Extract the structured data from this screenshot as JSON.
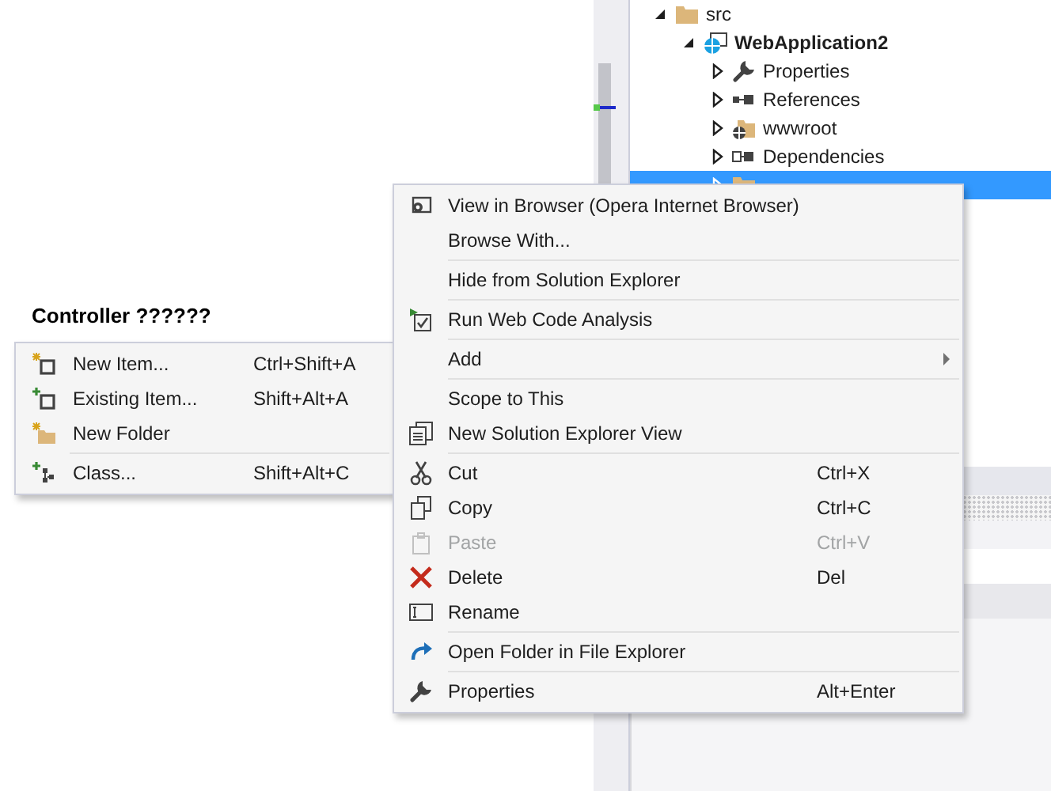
{
  "heading": "Controller ??????",
  "tree": [
    {
      "label": "src",
      "expanded": true,
      "selected": false,
      "children": [
        {
          "label": "WebApplication2",
          "expanded": true,
          "selected": false,
          "bold": true,
          "children": [
            {
              "label": "Properties",
              "expanded": false,
              "selected": false
            },
            {
              "label": "References",
              "expanded": false,
              "selected": false
            },
            {
              "label": "wwwroot",
              "expanded": false,
              "selected": false
            },
            {
              "label": "Dependencies",
              "expanded": false,
              "selected": false
            },
            {
              "expanded": false,
              "selected": true
            }
          ]
        }
      ]
    }
  ],
  "context_menu": {
    "items": [
      {
        "kind": "item",
        "label": "View in Browser (Opera Internet Browser)",
        "disabled": false,
        "submenu": false
      },
      {
        "kind": "item",
        "label": "Browse With...",
        "disabled": false,
        "submenu": false
      },
      {
        "kind": "separator"
      },
      {
        "kind": "item",
        "label": "Hide from Solution Explorer",
        "disabled": false,
        "submenu": false
      },
      {
        "kind": "separator"
      },
      {
        "kind": "item",
        "label": "Run Web Code Analysis",
        "disabled": false,
        "submenu": false
      },
      {
        "kind": "separator"
      },
      {
        "kind": "item",
        "label": "Add",
        "disabled": false,
        "submenu": true
      },
      {
        "kind": "separator"
      },
      {
        "kind": "item",
        "label": "Scope to This",
        "disabled": false,
        "submenu": false
      },
      {
        "kind": "item",
        "label": "New Solution Explorer View",
        "disabled": false,
        "submenu": false
      },
      {
        "kind": "separator"
      },
      {
        "kind": "item",
        "label": "Cut",
        "shortcut": "Ctrl+X",
        "disabled": false,
        "submenu": false
      },
      {
        "kind": "item",
        "label": "Copy",
        "shortcut": "Ctrl+C",
        "disabled": false,
        "submenu": false
      },
      {
        "kind": "item",
        "label": "Paste",
        "shortcut": "Ctrl+V",
        "disabled": true,
        "submenu": false
      },
      {
        "kind": "item",
        "label": "Delete",
        "shortcut": "Del",
        "disabled": false,
        "submenu": false
      },
      {
        "kind": "item",
        "label": "Rename",
        "disabled": false,
        "submenu": false
      },
      {
        "kind": "separator"
      },
      {
        "kind": "item",
        "label": "Open Folder in File Explorer",
        "disabled": false,
        "submenu": false
      },
      {
        "kind": "separator"
      },
      {
        "kind": "item",
        "label": "Properties",
        "shortcut": "Alt+Enter",
        "disabled": false,
        "submenu": false
      }
    ]
  },
  "add_submenu": {
    "items": [
      {
        "kind": "item",
        "label": "New Item...",
        "shortcut": "Ctrl+Shift+A",
        "disabled": false
      },
      {
        "kind": "item",
        "label": "Existing Item...",
        "shortcut": "Shift+Alt+A",
        "disabled": false
      },
      {
        "kind": "item",
        "label": "New Folder",
        "disabled": false
      },
      {
        "kind": "separator"
      },
      {
        "kind": "item",
        "label": "Class...",
        "shortcut": "Shift+Alt+C",
        "disabled": false
      }
    ]
  }
}
